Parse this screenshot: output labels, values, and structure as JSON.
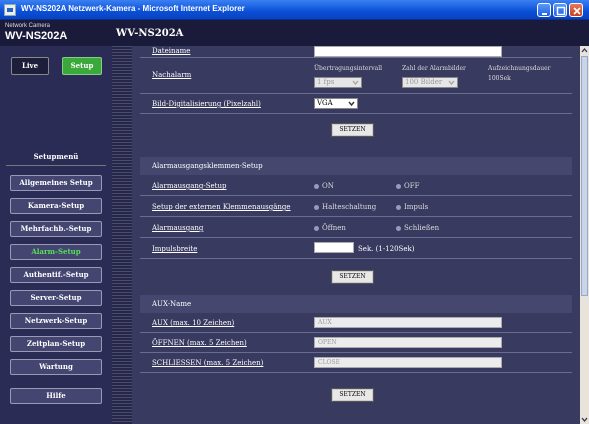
{
  "window": {
    "title": "WV-NS202A Netzwerk-Kamera - Microsoft Internet Explorer"
  },
  "header": {
    "brand_small": "Network Camera",
    "brand": "WV-NS202A",
    "model": "WV-NS202A"
  },
  "sidebar": {
    "live": "Live",
    "setup": "Setup",
    "menu_title": "Setupmenü",
    "items": [
      {
        "label": "Allgemeines Setup"
      },
      {
        "label": "Kamera-Setup"
      },
      {
        "label": "Mehrfachb.-Setup"
      },
      {
        "label": "Alarm-Setup",
        "active": true
      },
      {
        "label": "Authentif.-Setup"
      },
      {
        "label": "Server-Setup"
      },
      {
        "label": "Netzwerk-Setup"
      },
      {
        "label": "Zeitplan-Setup"
      },
      {
        "label": "Wartung"
      }
    ],
    "help": "Hilfe"
  },
  "top": {
    "dateiname": "Dateiname",
    "nachalarm": "Nachalarm",
    "uebertragungsintervall": "Übertragungsintervall",
    "intervall_value": "1 fps",
    "anzahl_label": "Zahl der Alarmbilder",
    "anzahl_value": "100 Bilder",
    "aufzeichnungsdauer_label": "Aufzeichnungsdauer",
    "aufzeichnungsdauer_value": "100Sek",
    "bild_label": "Bild-Digitalisierung (Pixelzahl)",
    "bild_value": "VGA",
    "setzen": "SETZEN"
  },
  "alarmausgang": {
    "header": "Alarmausgangsklemmen-Setup",
    "setup_label": "Alarmausgang-Setup",
    "on": "ON",
    "off": "OFF",
    "extern_label": "Setup der externen Klemmenausgänge",
    "halte": "Halteschaltung",
    "impuls": "Impuls",
    "ausgang_label": "Alarmausgang",
    "offnen": "Öffnen",
    "schliessen": "Schließen",
    "breite_label": "Impulsbreite",
    "breite_unit": "Sek. (1-120Sek)",
    "setzen": "SETZEN"
  },
  "aux": {
    "header": "AUX-Name",
    "aux_label": "AUX (max. 10 Zeichen)",
    "aux_value": "AUX",
    "offnen_label": "ÖFFNEN (max. 5 Zeichen)",
    "offnen_value": "OPEN",
    "schliessen_label": "SCHLIESSEN (max. 5 Zeichen)",
    "schliessen_value": "CLOSE",
    "setzen": "SETZEN"
  }
}
